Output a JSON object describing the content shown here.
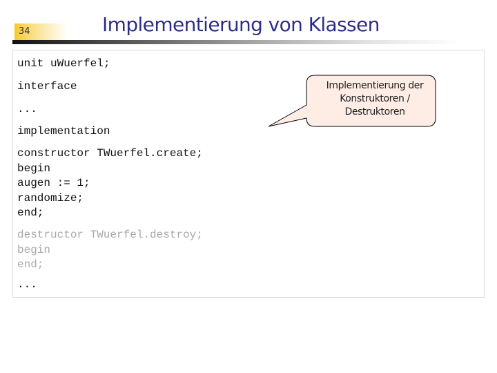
{
  "slide": {
    "number": "34",
    "title": "Implementierung von Klassen"
  },
  "code": {
    "unit_line": "unit uWuerfel;",
    "interface_line": "interface",
    "ellipsis_1": "...",
    "implementation_line": "implementation",
    "constructor_block": [
      "constructor TWuerfel.create;",
      "begin",
      "augen := 1;",
      "randomize;",
      "end;"
    ],
    "destructor_block": [
      "destructor TWuerfel.destroy;",
      "begin",
      "end;"
    ],
    "ellipsis_2": "..."
  },
  "callout": {
    "lines": [
      "Implementierung der",
      "Konstruktoren /",
      "Destruktoren"
    ],
    "fill_color": "#fdede5",
    "border_color": "#000000"
  },
  "colors": {
    "title": "#2e2e86",
    "dimmed_code": "#a8a8a8",
    "slide_number_accent": "#f7c82a"
  }
}
